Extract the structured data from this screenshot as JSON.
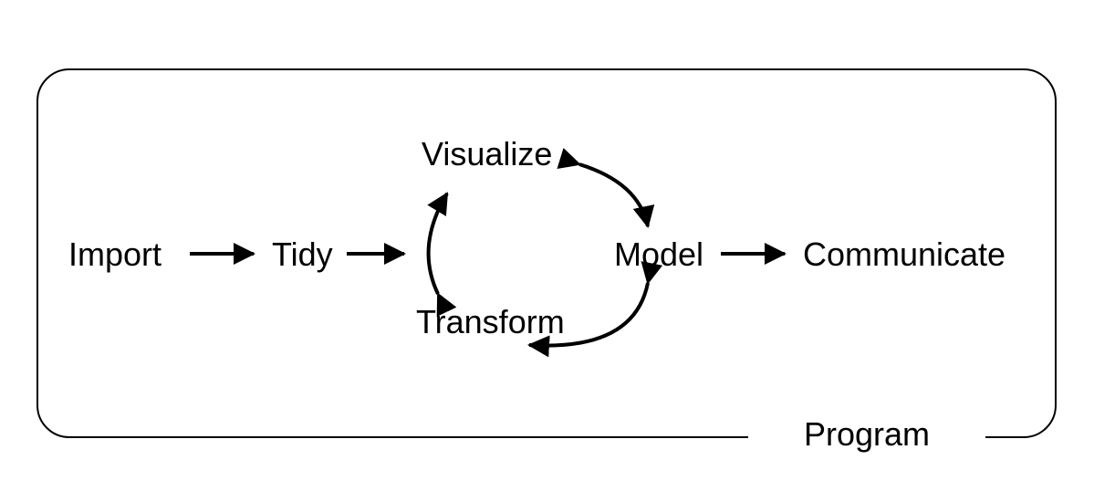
{
  "diagram": {
    "frame_label": "Program",
    "nodes": {
      "import": "Import",
      "tidy": "Tidy",
      "visualize": "Visualize",
      "transform": "Transform",
      "model": "Model",
      "communicate": "Communicate"
    },
    "edges": [
      {
        "from": "import",
        "to": "tidy",
        "style": "straight"
      },
      {
        "from": "tidy",
        "to": "cycle",
        "style": "straight"
      },
      {
        "from": "transform",
        "to": "visualize",
        "style": "curved-bidirectional"
      },
      {
        "from": "visualize",
        "to": "model",
        "style": "curved-bidirectional"
      },
      {
        "from": "model",
        "to": "transform",
        "style": "curved-bidirectional"
      },
      {
        "from": "model",
        "to": "communicate",
        "style": "straight"
      }
    ]
  }
}
